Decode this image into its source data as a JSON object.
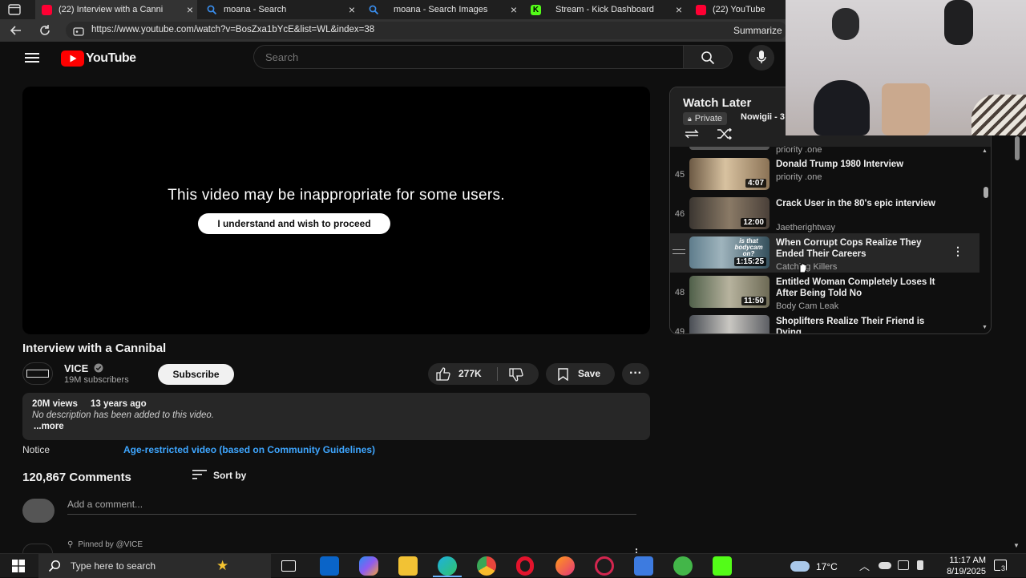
{
  "browser": {
    "tabs": [
      {
        "label": "(22) Interview with a Canni",
        "favicon": "youtube-icon",
        "active": true
      },
      {
        "label": "moana - Search",
        "favicon": "search-icon",
        "active": false
      },
      {
        "label": "moana - Search Images",
        "favicon": "search-icon",
        "active": false
      },
      {
        "label": "Stream - Kick Dashboard",
        "favicon": "kick-icon",
        "active": false
      },
      {
        "label": "(22) YouTube",
        "favicon": "youtube-icon",
        "active": false
      }
    ],
    "url": "https://www.youtube.com/watch?v=BosZxa1bYcE&list=WL&index=38",
    "summarize_label": "Summarize"
  },
  "youtube": {
    "logo_text": "YouTube",
    "search_placeholder": "Search",
    "player": {
      "warning": "This video may be inappropriate for some users.",
      "proceed_label": "I understand and wish to proceed"
    },
    "video": {
      "title": "Interview with a Cannibal",
      "channel": "VICE",
      "subscribers": "19M subscribers",
      "subscribe_label": "Subscribe",
      "likes": "277K",
      "save_label": "Save",
      "views": "20M views",
      "age": "13 years ago",
      "description": "No description has been added to this video.",
      "more_label": "...more",
      "notice_label": "Notice",
      "notice_text": "Age-restricted video (based on Community Guidelines)"
    },
    "comments": {
      "count": "120,867 Comments",
      "sort_label": "Sort by",
      "add_placeholder": "Add a comment...",
      "pinned_label": "Pinned by @VICE"
    },
    "playlist": {
      "title": "Watch Later",
      "privacy": "Private",
      "owner": "Nowigii - 3",
      "top_partial_channel": "priority .one",
      "items": [
        {
          "index": "45",
          "title": "Donald Trump 1980 Interview",
          "channel": "priority .one",
          "duration": "4:07"
        },
        {
          "index": "46",
          "title": "Crack User in the 80's epic interview",
          "channel": "Jaetherightway",
          "duration": "12:00"
        },
        {
          "index": "",
          "title": "When Corrupt Cops Realize They Ended Their Careers",
          "channel": "Catching Killers",
          "duration": "1:15:25",
          "thumb_text": "is that bodycam on?"
        },
        {
          "index": "48",
          "title": "Entitled Woman Completely Loses It After Being Told No",
          "channel": "Body Cam Leak",
          "duration": "11:50"
        },
        {
          "index": "49",
          "title": "Shoplifters Realize Their Friend is Dying",
          "channel": "",
          "duration": ""
        }
      ]
    }
  },
  "taskbar": {
    "search_placeholder": "Type here to search",
    "weather": "17°C",
    "time": "11:17 AM",
    "date": "8/19/2025",
    "notification_count": "3"
  },
  "colors": {
    "youtube_red": "#ff0000",
    "link_blue": "#3ea6ff",
    "kick_green": "#53fc18"
  }
}
